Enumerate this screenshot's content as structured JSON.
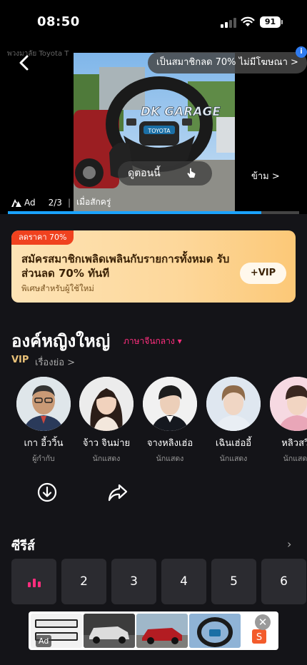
{
  "status_bar": {
    "time": "08:50",
    "battery": "91"
  },
  "video_ad": {
    "ghost_text": "พวงมาลัย Toyota T",
    "vip_banner": "เป็นสมาชิกลด 70% ไม่มีโฆษณา >",
    "info_badge": "i",
    "see_now": "ดูตอนนี้",
    "skip": "ข้าม >",
    "ad_label": "Ad",
    "counter": "2/3",
    "when_label": "เมื่อสักครู่",
    "progress": 0.87,
    "overlay_text": "DK GARAGE",
    "badge_text": "TOYOTA"
  },
  "promo": {
    "tag": "ลดราคา 70%",
    "title": "สมัครสมาชิกเพลิดเพลินกับรายการทั้งหมด รับส่วนลด 70% ทันที",
    "subtitle": "พิเศษสำหรับผู้ใช้ใหม่",
    "button": "+VIP"
  },
  "show": {
    "title": "องค์หญิงใหญ่",
    "language": "ภาษาจีนกลาง ▾",
    "vip": "VIP",
    "synopsis": "เรื่องย่อ >"
  },
  "cast": [
    {
      "name": "เกา อี้ววิ้น",
      "role": "ผู้กำกับ"
    },
    {
      "name": "จ้าว จินม่าย",
      "role": "นักแสดง"
    },
    {
      "name": "จางหลิงเฮ่อ",
      "role": "นักแสดง"
    },
    {
      "name": "เฉินเฮ่ออี้",
      "role": "นักแสดง"
    },
    {
      "name": "หลิวสวี่เ",
      "role": "นักแสดง"
    }
  ],
  "series": {
    "heading": "ซีรีส์",
    "arrow": "›",
    "episodes": [
      "2",
      "3",
      "4",
      "5",
      "6"
    ]
  },
  "bottom_ad": {
    "ad_label": "Ad",
    "close": "✕"
  }
}
